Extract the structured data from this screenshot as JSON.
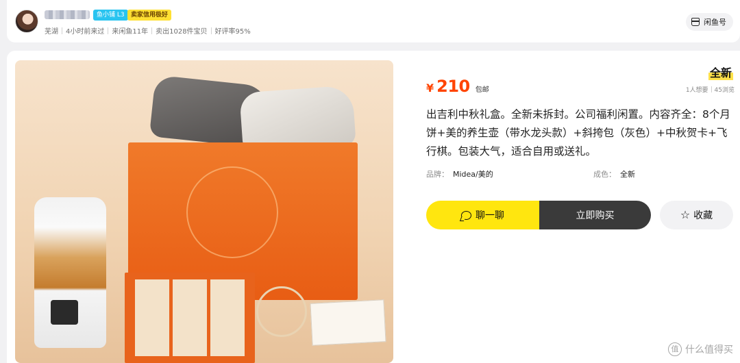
{
  "seller": {
    "level_badge": "鱼小铺 L3",
    "credit_badge": "卖家信用极好",
    "meta": [
      "芜湖",
      "4小时前来过",
      "来闲鱼11年",
      "卖出1028件宝贝",
      "好评率95%"
    ],
    "xianyu_button_label": "闲鱼号"
  },
  "product": {
    "condition_tag": "全新",
    "price_currency": "¥",
    "price_amount": "210",
    "shipping": "包邮",
    "wants": "1人想要",
    "views": "45浏览",
    "description": "出吉利中秋礼盒。全新未拆封。公司福利闲置。内容齐全：8个月饼+美的养生壶（带水龙头款）+斜挎包（灰色）+中秋贺卡+飞行棋。包装大气，适合自用或送礼。",
    "attributes": [
      {
        "key": "品牌：",
        "value": "Midea/美的"
      },
      {
        "key": "成色：",
        "value": "全新"
      }
    ]
  },
  "actions": {
    "chat_label": "聊一聊",
    "buy_label": "立即购买",
    "favorite_label": "收藏"
  },
  "watermark": {
    "icon_text": "值",
    "text": "什么值得买"
  },
  "colors": {
    "accent_yellow": "#ffe60f",
    "price_red": "#ff4400",
    "buy_dark": "#3a3a3a",
    "level_badge_blue": "#29c4f0",
    "credit_badge_yellow": "#ffe033"
  },
  "icons": [
    "store-icon",
    "chat-icon",
    "star-icon"
  ]
}
